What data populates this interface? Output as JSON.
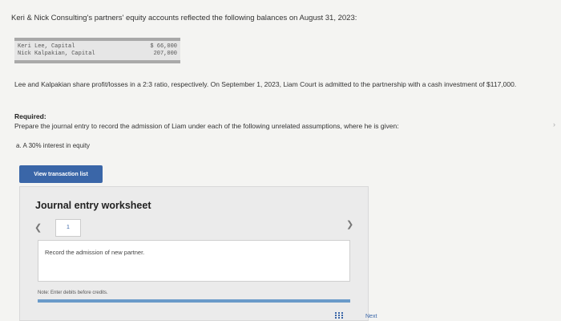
{
  "intro": "Keri & Nick Consulting's partners' equity accounts reflected the following balances on August 31, 2023:",
  "balances": [
    {
      "name": "Keri Lee, Capital",
      "amount": "$ 66,000"
    },
    {
      "name": "Nick Kalpakian, Capital",
      "amount": "207,000"
    }
  ],
  "paragraph": "Lee and Kalpakian share profit/losses in a 2:3 ratio, respectively. On September 1, 2023, Liam Court is admitted to the partnership with a cash investment of $117,000.",
  "required": {
    "heading": "Required:",
    "text": "Prepare the journal entry to record the admission of Liam under each of the following unrelated assumptions, where he is given:",
    "part_a": "a. A 30% interest in equity"
  },
  "buttons": {
    "view_transactions": "View transaction list"
  },
  "worksheet": {
    "title": "Journal entry worksheet",
    "page": "1",
    "entry_label": "Record the admission of new partner.",
    "note": "Note: Enter debits before credits.",
    "next_label": "Next"
  },
  "icons": {
    "prev": "chevron-left-icon",
    "next": "chevron-right-icon",
    "grid": "grid-icon"
  },
  "colors": {
    "accent": "#3a66a8",
    "bar": "#6a9ac9"
  }
}
